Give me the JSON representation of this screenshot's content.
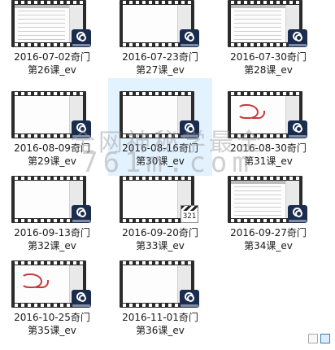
{
  "items": [
    {
      "label_line1": "2016-07-02奇门",
      "label_line2": "第26课_ev",
      "thumb": "notes",
      "overlay": "player-icon"
    },
    {
      "label_line1": "2016-07-23奇门",
      "label_line2": "第27课_ev",
      "thumb": "blank",
      "overlay": "player-icon"
    },
    {
      "label_line1": "2016-07-30奇门",
      "label_line2": "第28课_ev",
      "thumb": "notes",
      "overlay": "player-icon"
    },
    {
      "label_line1": "2016-08-09奇门",
      "label_line2": "第29课_ev",
      "thumb": "blank",
      "overlay": "player-icon"
    },
    {
      "label_line1": "2016-08-16奇门",
      "label_line2": "第30课_ev",
      "thumb": "blank",
      "overlay": "player-icon"
    },
    {
      "label_line1": "2016-08-30奇门",
      "label_line2": "第31课_ev",
      "thumb": "doodle",
      "overlay": "player-icon"
    },
    {
      "label_line1": "2016-09-13奇门",
      "label_line2": "第32课_ev",
      "thumb": "blank",
      "overlay": "player-icon"
    },
    {
      "label_line1": "2016-09-20奇门",
      "label_line2": "第33课_ev",
      "thumb": "blank",
      "overlay": "clapperboard",
      "clap_number": "321"
    },
    {
      "label_line1": "2016-09-27奇门",
      "label_line2": "第34课_ev",
      "thumb": "notes",
      "overlay": "player-icon"
    },
    {
      "label_line1": "2016-10-25奇门",
      "label_line2": "第35课_ev",
      "thumb": "doodle",
      "overlay": "player-icon"
    },
    {
      "label_line1": "2016-11-01奇门",
      "label_line2": "第36课_ev",
      "thumb": "blank",
      "overlay": "player-icon"
    }
  ],
  "watermark": {
    "line1": "全网神秘学最全",
    "line2": "761m.com"
  },
  "colors": {
    "selection": "#cce8ff",
    "film": "#2b2b2b",
    "badge": "#1b2d4f"
  }
}
